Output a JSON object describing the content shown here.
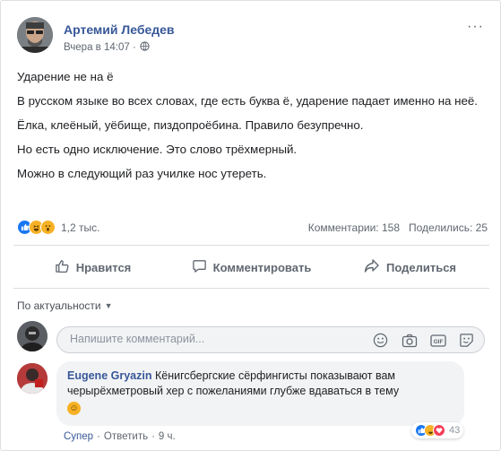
{
  "post": {
    "author": "Артемий Лебедев",
    "timestamp": "Вчера в 14:07 ·",
    "privacy_icon": "globe-icon",
    "more_label": "···",
    "paragraphs": [
      "Ударение не на ё",
      "В русском языке во всех словах, где есть буква ё, ударение падает именно на неё.",
      "Ёлка, клеёный, уёбище, пиздопроёбина. Правило безупречно.",
      "Но есть одно исключение. Это слово трёхмерный.",
      "Можно в следующий раз училке нос утереть."
    ]
  },
  "stats": {
    "reactions": [
      "like",
      "haha",
      "wow"
    ],
    "reaction_count": "1,2 тыс.",
    "comments": "Комментарии: 158",
    "shares": "Поделились: 25"
  },
  "actions": {
    "like": "Нравится",
    "comment": "Комментировать",
    "share": "Поделиться"
  },
  "sort": {
    "label": "По актуальности"
  },
  "composer": {
    "placeholder": "Напишите комментарий...",
    "icons": [
      "emoji-icon",
      "camera-icon",
      "gif-icon",
      "sticker-icon"
    ]
  },
  "comment": {
    "author": "Eugene Gryazin",
    "text": " Кёнигсбергские сёрфингисты показывают вам черырёхметровый хер с пожеланиями глубже вдаваться в тему",
    "reactions": [
      "like",
      "haha",
      "love"
    ],
    "reaction_count": "43",
    "like_link": "Супер",
    "reply_link": "Ответить",
    "time": "9 ч."
  },
  "colors": {
    "link": "#385898",
    "secondary_text": "#606770",
    "like_blue": "#1877f2",
    "bubble_bg": "#f2f3f5"
  }
}
